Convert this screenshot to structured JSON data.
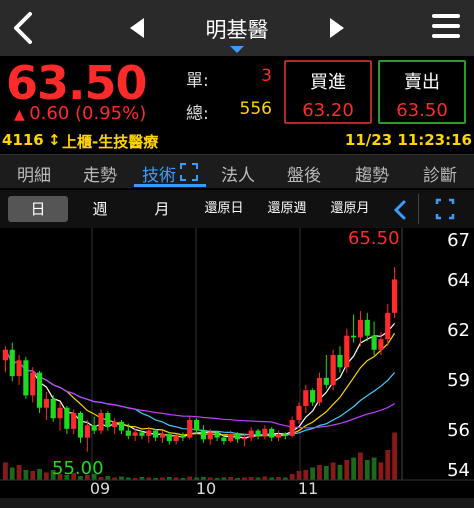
{
  "header": {
    "title": "明基醫"
  },
  "quote": {
    "price": "63.50",
    "change": "0.60 (0.95%)",
    "unit_label": "單:",
    "unit_value": "3",
    "total_label": "總:",
    "total_value": "556",
    "bid_label": "買進",
    "bid_value": "63.20",
    "ask_label": "賣出",
    "ask_value": "63.50",
    "code": "4116",
    "market": "上櫃-生技醫療",
    "datetime": "11/23 11:23:16"
  },
  "tabs": [
    "明細",
    "走勢",
    "技術",
    "法人",
    "盤後",
    "趨勢",
    "診斷"
  ],
  "active_tab": "技術",
  "periods": {
    "day": "日",
    "week": "週",
    "month": "月",
    "restore_day": "還原日",
    "restore_week": "還原週",
    "restore_month": "還原月"
  },
  "colors": {
    "up": "#ff2a2a",
    "down": "#1ddc1d",
    "accent": "#3b9cff",
    "ma5": "#ffffff",
    "ma10": "#ffd400",
    "ma20": "#3fd0ff",
    "ma60": "#c040ff"
  },
  "chart_data": {
    "type": "candlestick",
    "high_label": "65.50",
    "low_label": "55.00",
    "x_ticks": [
      "09",
      "10",
      "11"
    ],
    "y_ticks": [
      "67",
      "64",
      "62",
      "59",
      "56",
      "54"
    ],
    "ylim": [
      53.5,
      67.5
    ],
    "candles": [
      [
        60.2,
        61.0,
        59.5,
        60.8
      ],
      [
        60.8,
        61.2,
        59.0,
        59.3
      ],
      [
        59.3,
        60.5,
        58.8,
        60.2
      ],
      [
        60.2,
        60.4,
        58.0,
        58.2
      ],
      [
        58.2,
        59.8,
        57.8,
        59.5
      ],
      [
        59.5,
        59.6,
        57.2,
        57.5
      ],
      [
        57.5,
        58.4,
        56.8,
        58.0
      ],
      [
        58.0,
        58.2,
        56.7,
        56.9
      ],
      [
        56.9,
        57.8,
        56.2,
        57.5
      ],
      [
        57.5,
        57.6,
        56.0,
        56.3
      ],
      [
        56.3,
        57.4,
        56.0,
        57.2
      ],
      [
        57.2,
        57.3,
        55.5,
        55.8
      ],
      [
        55.8,
        56.8,
        55.0,
        56.5
      ],
      [
        56.5,
        57.0,
        56.0,
        56.2
      ],
      [
        56.2,
        57.4,
        56.0,
        57.2
      ],
      [
        57.2,
        57.3,
        56.2,
        56.4
      ],
      [
        56.4,
        56.9,
        56.0,
        56.7
      ],
      [
        56.7,
        56.8,
        56.0,
        56.2
      ],
      [
        56.2,
        56.6,
        55.7,
        55.9
      ],
      [
        55.9,
        56.3,
        55.6,
        56.1
      ],
      [
        56.1,
        56.2,
        55.7,
        55.9
      ],
      [
        55.9,
        56.4,
        55.5,
        56.2
      ],
      [
        56.2,
        56.3,
        55.6,
        55.8
      ],
      [
        55.8,
        56.2,
        55.5,
        56.0
      ],
      [
        56.0,
        56.1,
        55.4,
        55.6
      ],
      [
        55.6,
        56.0,
        55.4,
        55.9
      ],
      [
        55.9,
        56.1,
        55.6,
        55.8
      ],
      [
        55.8,
        57.0,
        55.7,
        56.8
      ],
      [
        56.8,
        56.9,
        56.0,
        56.2
      ],
      [
        56.2,
        56.5,
        55.5,
        55.7
      ],
      [
        55.7,
        56.3,
        55.4,
        56.1
      ],
      [
        56.1,
        56.2,
        55.6,
        55.8
      ],
      [
        55.8,
        56.0,
        55.4,
        55.6
      ],
      [
        55.6,
        56.2,
        55.5,
        56.0
      ],
      [
        56.0,
        56.1,
        55.5,
        55.7
      ],
      [
        55.7,
        56.0,
        55.3,
        55.8
      ],
      [
        55.8,
        56.4,
        55.6,
        56.2
      ],
      [
        56.2,
        56.3,
        55.7,
        55.9
      ],
      [
        55.9,
        56.5,
        55.7,
        56.3
      ],
      [
        56.3,
        56.4,
        55.6,
        55.8
      ],
      [
        55.8,
        56.2,
        55.6,
        56.0
      ],
      [
        56.0,
        56.1,
        55.7,
        55.9
      ],
      [
        55.9,
        57.0,
        55.8,
        56.8
      ],
      [
        56.8,
        57.8,
        56.6,
        57.6
      ],
      [
        57.6,
        58.8,
        57.2,
        58.5
      ],
      [
        58.5,
        58.6,
        57.6,
        57.8
      ],
      [
        57.8,
        59.5,
        57.6,
        59.2
      ],
      [
        59.2,
        60.5,
        58.6,
        58.8
      ],
      [
        58.8,
        60.8,
        58.5,
        60.5
      ],
      [
        60.5,
        61.0,
        59.5,
        59.8
      ],
      [
        59.8,
        62.0,
        59.5,
        61.6
      ],
      [
        61.6,
        62.8,
        61.2,
        61.5
      ],
      [
        61.5,
        63.0,
        61.0,
        62.5
      ],
      [
        62.5,
        62.9,
        61.3,
        61.6
      ],
      [
        61.6,
        62.4,
        60.5,
        60.8
      ],
      [
        60.8,
        61.8,
        60.5,
        61.4
      ],
      [
        61.4,
        63.4,
        61.0,
        62.9
      ],
      [
        62.9,
        65.5,
        62.6,
        64.8
      ]
    ],
    "volumes": [
      0.35,
      0.25,
      0.3,
      0.2,
      0.18,
      0.22,
      0.15,
      0.2,
      0.12,
      0.1,
      0.14,
      0.08,
      0.1,
      0.12,
      0.06,
      0.08,
      0.05,
      0.07,
      0.05,
      0.04,
      0.06,
      0.05,
      0.04,
      0.05,
      0.06,
      0.05,
      0.04,
      0.07,
      0.05,
      0.06,
      0.05,
      0.04,
      0.05,
      0.06,
      0.04,
      0.05,
      0.06,
      0.05,
      0.07,
      0.05,
      0.06,
      0.05,
      0.12,
      0.18,
      0.2,
      0.25,
      0.3,
      0.28,
      0.35,
      0.3,
      0.4,
      0.45,
      0.55,
      0.4,
      0.45,
      0.35,
      0.6,
      0.95
    ]
  }
}
